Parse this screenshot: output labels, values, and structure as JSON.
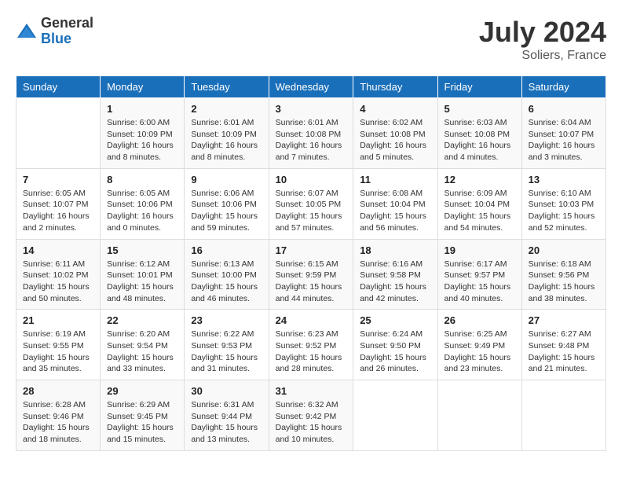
{
  "header": {
    "logo_general": "General",
    "logo_blue": "Blue",
    "month_title": "July 2024",
    "location": "Soliers, France"
  },
  "days_of_week": [
    "Sunday",
    "Monday",
    "Tuesday",
    "Wednesday",
    "Thursday",
    "Friday",
    "Saturday"
  ],
  "weeks": [
    [
      {
        "day": "",
        "sunrise": "",
        "sunset": "",
        "daylight": ""
      },
      {
        "day": "1",
        "sunrise": "Sunrise: 6:00 AM",
        "sunset": "Sunset: 10:09 PM",
        "daylight": "Daylight: 16 hours and 8 minutes."
      },
      {
        "day": "2",
        "sunrise": "Sunrise: 6:01 AM",
        "sunset": "Sunset: 10:09 PM",
        "daylight": "Daylight: 16 hours and 8 minutes."
      },
      {
        "day": "3",
        "sunrise": "Sunrise: 6:01 AM",
        "sunset": "Sunset: 10:08 PM",
        "daylight": "Daylight: 16 hours and 7 minutes."
      },
      {
        "day": "4",
        "sunrise": "Sunrise: 6:02 AM",
        "sunset": "Sunset: 10:08 PM",
        "daylight": "Daylight: 16 hours and 5 minutes."
      },
      {
        "day": "5",
        "sunrise": "Sunrise: 6:03 AM",
        "sunset": "Sunset: 10:08 PM",
        "daylight": "Daylight: 16 hours and 4 minutes."
      },
      {
        "day": "6",
        "sunrise": "Sunrise: 6:04 AM",
        "sunset": "Sunset: 10:07 PM",
        "daylight": "Daylight: 16 hours and 3 minutes."
      }
    ],
    [
      {
        "day": "7",
        "sunrise": "Sunrise: 6:05 AM",
        "sunset": "Sunset: 10:07 PM",
        "daylight": "Daylight: 16 hours and 2 minutes."
      },
      {
        "day": "8",
        "sunrise": "Sunrise: 6:05 AM",
        "sunset": "Sunset: 10:06 PM",
        "daylight": "Daylight: 16 hours and 0 minutes."
      },
      {
        "day": "9",
        "sunrise": "Sunrise: 6:06 AM",
        "sunset": "Sunset: 10:06 PM",
        "daylight": "Daylight: 15 hours and 59 minutes."
      },
      {
        "day": "10",
        "sunrise": "Sunrise: 6:07 AM",
        "sunset": "Sunset: 10:05 PM",
        "daylight": "Daylight: 15 hours and 57 minutes."
      },
      {
        "day": "11",
        "sunrise": "Sunrise: 6:08 AM",
        "sunset": "Sunset: 10:04 PM",
        "daylight": "Daylight: 15 hours and 56 minutes."
      },
      {
        "day": "12",
        "sunrise": "Sunrise: 6:09 AM",
        "sunset": "Sunset: 10:04 PM",
        "daylight": "Daylight: 15 hours and 54 minutes."
      },
      {
        "day": "13",
        "sunrise": "Sunrise: 6:10 AM",
        "sunset": "Sunset: 10:03 PM",
        "daylight": "Daylight: 15 hours and 52 minutes."
      }
    ],
    [
      {
        "day": "14",
        "sunrise": "Sunrise: 6:11 AM",
        "sunset": "Sunset: 10:02 PM",
        "daylight": "Daylight: 15 hours and 50 minutes."
      },
      {
        "day": "15",
        "sunrise": "Sunrise: 6:12 AM",
        "sunset": "Sunset: 10:01 PM",
        "daylight": "Daylight: 15 hours and 48 minutes."
      },
      {
        "day": "16",
        "sunrise": "Sunrise: 6:13 AM",
        "sunset": "Sunset: 10:00 PM",
        "daylight": "Daylight: 15 hours and 46 minutes."
      },
      {
        "day": "17",
        "sunrise": "Sunrise: 6:15 AM",
        "sunset": "Sunset: 9:59 PM",
        "daylight": "Daylight: 15 hours and 44 minutes."
      },
      {
        "day": "18",
        "sunrise": "Sunrise: 6:16 AM",
        "sunset": "Sunset: 9:58 PM",
        "daylight": "Daylight: 15 hours and 42 minutes."
      },
      {
        "day": "19",
        "sunrise": "Sunrise: 6:17 AM",
        "sunset": "Sunset: 9:57 PM",
        "daylight": "Daylight: 15 hours and 40 minutes."
      },
      {
        "day": "20",
        "sunrise": "Sunrise: 6:18 AM",
        "sunset": "Sunset: 9:56 PM",
        "daylight": "Daylight: 15 hours and 38 minutes."
      }
    ],
    [
      {
        "day": "21",
        "sunrise": "Sunrise: 6:19 AM",
        "sunset": "Sunset: 9:55 PM",
        "daylight": "Daylight: 15 hours and 35 minutes."
      },
      {
        "day": "22",
        "sunrise": "Sunrise: 6:20 AM",
        "sunset": "Sunset: 9:54 PM",
        "daylight": "Daylight: 15 hours and 33 minutes."
      },
      {
        "day": "23",
        "sunrise": "Sunrise: 6:22 AM",
        "sunset": "Sunset: 9:53 PM",
        "daylight": "Daylight: 15 hours and 31 minutes."
      },
      {
        "day": "24",
        "sunrise": "Sunrise: 6:23 AM",
        "sunset": "Sunset: 9:52 PM",
        "daylight": "Daylight: 15 hours and 28 minutes."
      },
      {
        "day": "25",
        "sunrise": "Sunrise: 6:24 AM",
        "sunset": "Sunset: 9:50 PM",
        "daylight": "Daylight: 15 hours and 26 minutes."
      },
      {
        "day": "26",
        "sunrise": "Sunrise: 6:25 AM",
        "sunset": "Sunset: 9:49 PM",
        "daylight": "Daylight: 15 hours and 23 minutes."
      },
      {
        "day": "27",
        "sunrise": "Sunrise: 6:27 AM",
        "sunset": "Sunset: 9:48 PM",
        "daylight": "Daylight: 15 hours and 21 minutes."
      }
    ],
    [
      {
        "day": "28",
        "sunrise": "Sunrise: 6:28 AM",
        "sunset": "Sunset: 9:46 PM",
        "daylight": "Daylight: 15 hours and 18 minutes."
      },
      {
        "day": "29",
        "sunrise": "Sunrise: 6:29 AM",
        "sunset": "Sunset: 9:45 PM",
        "daylight": "Daylight: 15 hours and 15 minutes."
      },
      {
        "day": "30",
        "sunrise": "Sunrise: 6:31 AM",
        "sunset": "Sunset: 9:44 PM",
        "daylight": "Daylight: 15 hours and 13 minutes."
      },
      {
        "day": "31",
        "sunrise": "Sunrise: 6:32 AM",
        "sunset": "Sunset: 9:42 PM",
        "daylight": "Daylight: 15 hours and 10 minutes."
      },
      {
        "day": "",
        "sunrise": "",
        "sunset": "",
        "daylight": ""
      },
      {
        "day": "",
        "sunrise": "",
        "sunset": "",
        "daylight": ""
      },
      {
        "day": "",
        "sunrise": "",
        "sunset": "",
        "daylight": ""
      }
    ]
  ]
}
